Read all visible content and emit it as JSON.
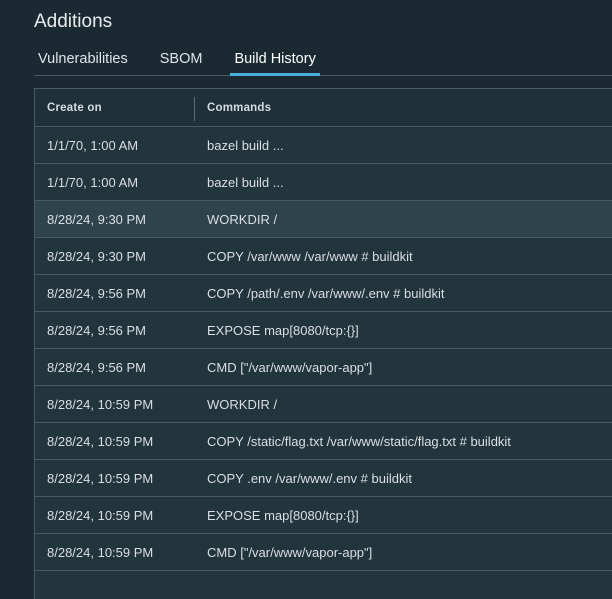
{
  "section": {
    "title": "Additions"
  },
  "tabs": [
    {
      "label": "Vulnerabilities",
      "active": false
    },
    {
      "label": "SBOM",
      "active": false
    },
    {
      "label": "Build History",
      "active": true
    }
  ],
  "table": {
    "columns": {
      "created": "Create on",
      "commands": "Commands"
    },
    "rows": [
      {
        "created": "1/1/70, 1:00 AM",
        "command": "bazel build ..."
      },
      {
        "created": "1/1/70, 1:00 AM",
        "command": "bazel build ..."
      },
      {
        "created": "8/28/24, 9:30 PM",
        "command": "WORKDIR /"
      },
      {
        "created": "8/28/24, 9:30 PM",
        "command": "COPY /var/www /var/www # buildkit"
      },
      {
        "created": "8/28/24, 9:56 PM",
        "command": "COPY /path/.env /var/www/.env # buildkit"
      },
      {
        "created": "8/28/24, 9:56 PM",
        "command": "EXPOSE map[8080/tcp:{}]"
      },
      {
        "created": "8/28/24, 9:56 PM",
        "command": "CMD [\"/var/www/vapor-app\"]"
      },
      {
        "created": "8/28/24, 10:59 PM",
        "command": "WORKDIR /"
      },
      {
        "created": "8/28/24, 10:59 PM",
        "command": "COPY /static/flag.txt /var/www/static/flag.txt # buildkit"
      },
      {
        "created": "8/28/24, 10:59 PM",
        "command": "COPY .env /var/www/.env # buildkit"
      },
      {
        "created": "8/28/24, 10:59 PM",
        "command": "EXPOSE map[8080/tcp:{}]"
      },
      {
        "created": "8/28/24, 10:59 PM",
        "command": "CMD [\"/var/www/vapor-app\"]"
      }
    ],
    "highlighted_row": 2
  },
  "colors": {
    "background": "#1b2a32",
    "accent": "#49afd9",
    "row_hover": "#2f434d"
  }
}
